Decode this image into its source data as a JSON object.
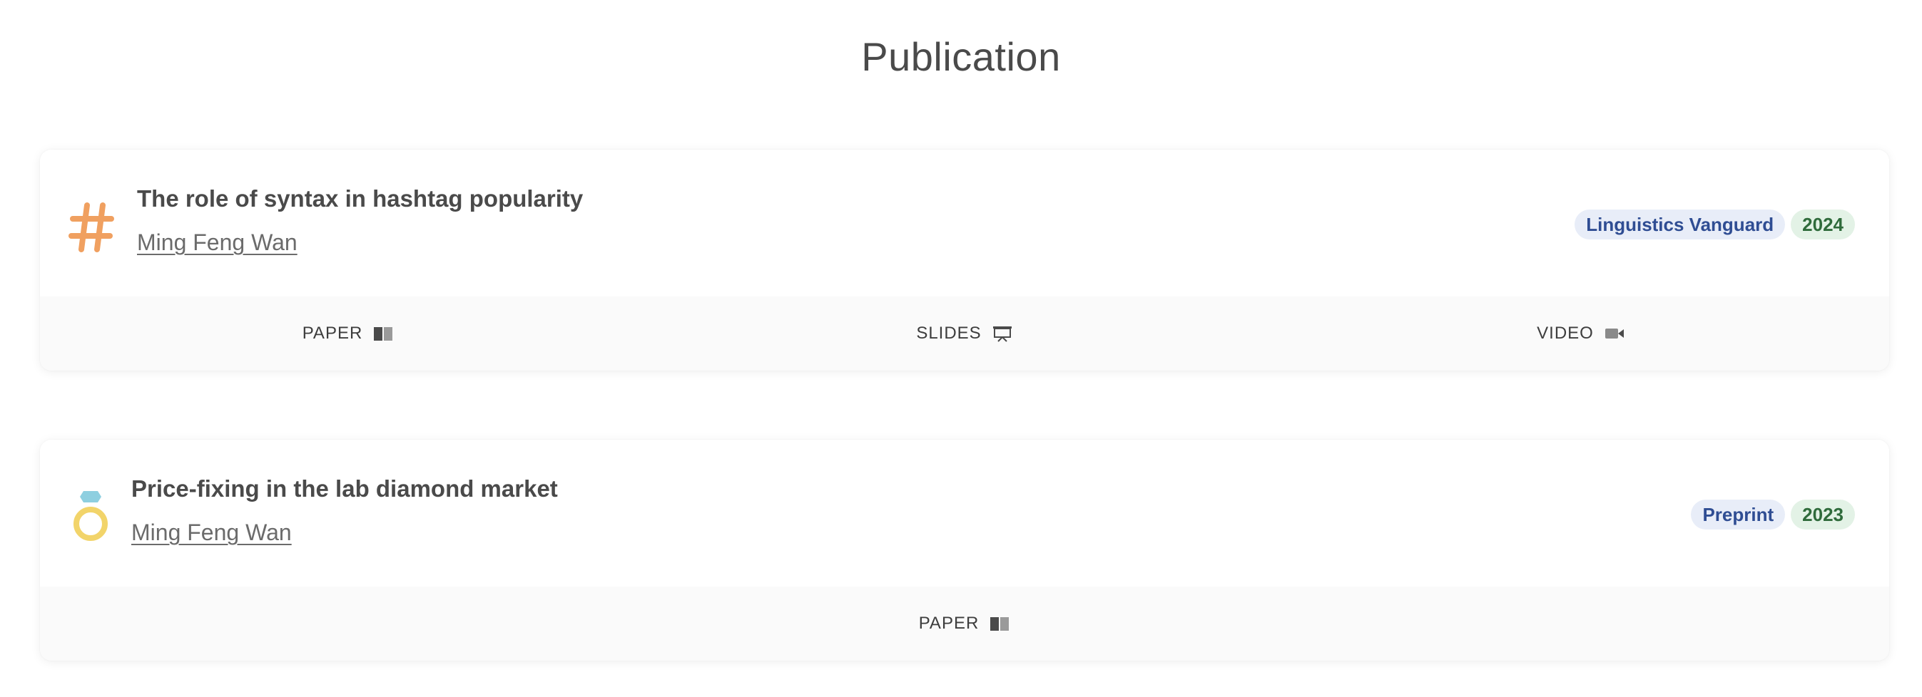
{
  "page": {
    "title": "Publication"
  },
  "publications": [
    {
      "icon": "hashtag-icon",
      "title": "The role of syntax in hashtag popularity",
      "author": "Ming Feng Wan",
      "venue": "Linguistics Vanguard",
      "year": "2024",
      "links": [
        {
          "label": "PAPER",
          "icon": "book-icon"
        },
        {
          "label": "SLIDES",
          "icon": "presentation-icon"
        },
        {
          "label": "VIDEO",
          "icon": "video-camera-icon"
        }
      ]
    },
    {
      "icon": "diamond-ring-icon",
      "title": "Price-fixing in the lab diamond market",
      "author": "Ming Feng Wan",
      "venue": "Preprint",
      "year": "2023",
      "links": [
        {
          "label": "PAPER",
          "icon": "book-icon"
        }
      ]
    }
  ],
  "colors": {
    "venue_tag_bg": "#e8edf8",
    "venue_tag_text": "#2f4d93",
    "year_tag_bg": "#e3f2e6",
    "year_tag_text": "#2f6b3b",
    "hashtag_icon": "#f0a060",
    "ring_band": "#f2d46a",
    "ring_gem": "#8ecfe0"
  }
}
